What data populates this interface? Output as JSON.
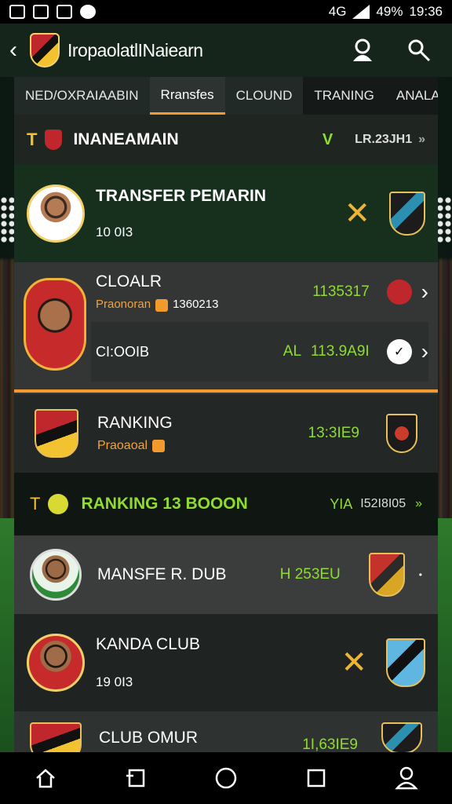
{
  "status": {
    "battery": "49%",
    "time": "19:36",
    "signal_label": "4G"
  },
  "appbar": {
    "title": "IropaolatlINaiearn",
    "back_icon": "back-arrow-icon"
  },
  "tabs": [
    {
      "label": "NED/OXRAIAABIN"
    },
    {
      "label": "Rransfes"
    },
    {
      "label": "CLOUND"
    },
    {
      "label": "TRANING"
    },
    {
      "label": "ANALAS"
    }
  ],
  "section1": {
    "prefix": "T",
    "title": "INANEAMAIN",
    "mark": "V",
    "code": "LR.23JH1"
  },
  "card1": {
    "name": "TRANSFER PEMARIN",
    "value": "10 0I3"
  },
  "card2": {
    "name": "CLOALR",
    "sub": "Praonoran",
    "sub_value": "1360213",
    "amount": "1135317",
    "line2_label": "CI:OOIB",
    "line2_prefix": "AL",
    "line2_amount": "113.9A9I"
  },
  "card3": {
    "name": "RANKING",
    "sub": "Praoaoal",
    "amount": "13:3IE9"
  },
  "section2": {
    "prefix": "T",
    "title": "RANKING 13 BOOON",
    "mark": "YIA",
    "code": "I52I8I05"
  },
  "card4": {
    "name": "MANSFE R. DUB",
    "amount": "H 253EU"
  },
  "card5": {
    "name": "KANDA CLUB",
    "value": "19 0I3"
  },
  "card6": {
    "name": "CLUB OMUR",
    "amount": "1I,63IE9"
  },
  "colors": {
    "accent": "#f29a2e",
    "green": "#8fdc2f",
    "panel": "#1e2420"
  }
}
